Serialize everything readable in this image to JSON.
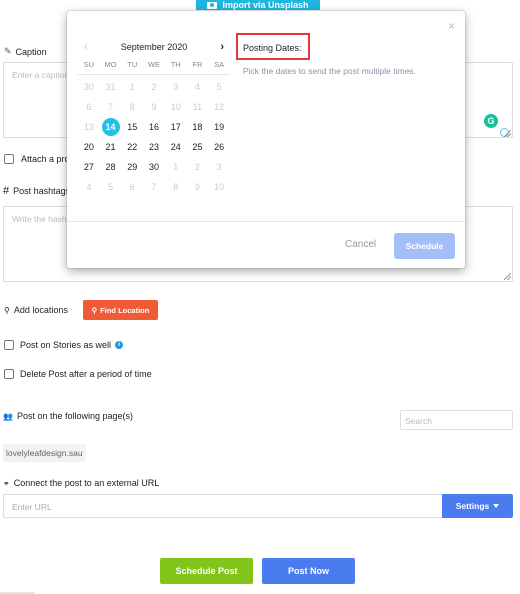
{
  "unsplash": {
    "label": "Import via Unsplash",
    "icon": "camera-icon"
  },
  "caption": {
    "label": "Caption",
    "icon": "edit-icon",
    "placeholder": "Enter a caption"
  },
  "attach": {
    "label": "Attach a product"
  },
  "hashtags": {
    "label": "Post hashtags",
    "icon": "hash-icon",
    "placeholder": "Write the hashtags"
  },
  "locations": {
    "label": "Add locations",
    "icon": "map-pin-icon",
    "button": "Find Location"
  },
  "stories": {
    "label": "Post on Stories as well",
    "info": "i"
  },
  "delete_post": {
    "label": "Delete Post after a period of time"
  },
  "pages": {
    "label": "Post on the following page(s)",
    "icon": "users-icon",
    "search_placeholder": "Search",
    "selected": [
      "lovelyleafdesign.sau"
    ]
  },
  "external_url": {
    "label": "Connect the post to an external URL",
    "icon": "link-icon",
    "placeholder": "Enter URL",
    "settings_button": "Settings"
  },
  "actions": {
    "schedule_post": "Schedule Post",
    "post_now": "Post Now"
  },
  "grammarly": {
    "letter": "G"
  },
  "modal": {
    "close": "×",
    "calendar": {
      "month_label": "September 2020",
      "prev": "‹",
      "next": "›",
      "weekdays": [
        "SU",
        "MO",
        "TU",
        "WE",
        "TH",
        "FR",
        "SA"
      ],
      "weeks": [
        [
          {
            "d": "30",
            "m": true
          },
          {
            "d": "31",
            "m": true
          },
          {
            "d": "1",
            "m": true
          },
          {
            "d": "2",
            "m": true
          },
          {
            "d": "3",
            "m": true
          },
          {
            "d": "4",
            "m": true
          },
          {
            "d": "5",
            "m": true
          }
        ],
        [
          {
            "d": "6",
            "m": true
          },
          {
            "d": "7",
            "m": true
          },
          {
            "d": "8",
            "m": true
          },
          {
            "d": "9",
            "m": true
          },
          {
            "d": "10",
            "m": true
          },
          {
            "d": "11",
            "m": true
          },
          {
            "d": "12",
            "m": true
          }
        ],
        [
          {
            "d": "13",
            "m": true
          },
          {
            "d": "14",
            "sel": true
          },
          {
            "d": "15"
          },
          {
            "d": "16"
          },
          {
            "d": "17"
          },
          {
            "d": "18"
          },
          {
            "d": "19"
          }
        ],
        [
          {
            "d": "20"
          },
          {
            "d": "21"
          },
          {
            "d": "22"
          },
          {
            "d": "23"
          },
          {
            "d": "24"
          },
          {
            "d": "25"
          },
          {
            "d": "26"
          }
        ],
        [
          {
            "d": "27"
          },
          {
            "d": "28"
          },
          {
            "d": "29"
          },
          {
            "d": "30"
          },
          {
            "d": "1",
            "m": true
          },
          {
            "d": "2",
            "m": true
          },
          {
            "d": "3",
            "m": true
          }
        ],
        [
          {
            "d": "4",
            "m": true
          },
          {
            "d": "5",
            "m": true
          },
          {
            "d": "6",
            "m": true
          },
          {
            "d": "7",
            "m": true
          },
          {
            "d": "8",
            "m": true
          },
          {
            "d": "9",
            "m": true
          },
          {
            "d": "10",
            "m": true
          }
        ]
      ],
      "selected_date": "2020-09-14"
    },
    "posting_dates_title": "Posting Dates:",
    "posting_dates_desc": "Pick the dates to send the post multiple times.",
    "cancel": "Cancel",
    "schedule": "Schedule"
  },
  "colors": {
    "accent_blue": "#4a7cf0",
    "green": "#82c51a",
    "orange": "#f05a35",
    "selected_day": "#22c0ea",
    "highlight_box": "#e5363c"
  }
}
